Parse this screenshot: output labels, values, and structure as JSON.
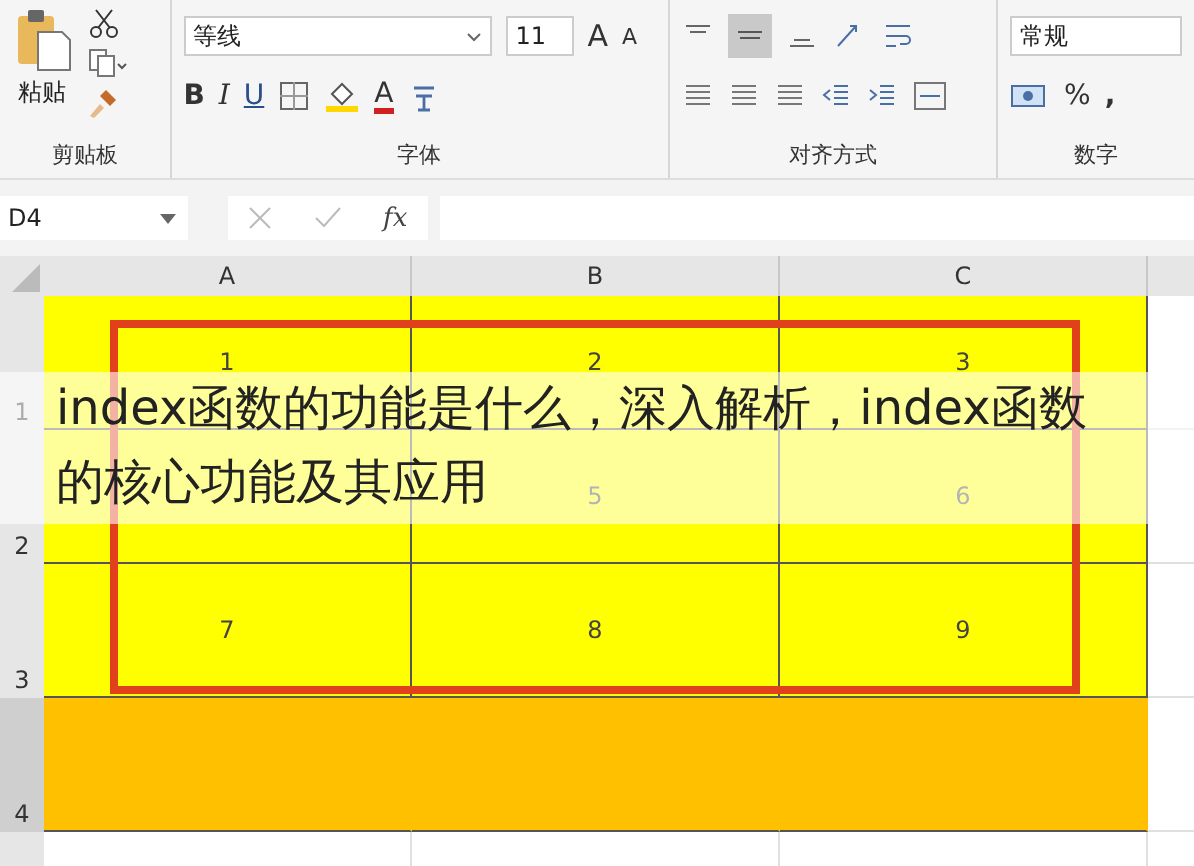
{
  "ribbon": {
    "paste_label": "粘贴",
    "font_name": "等线",
    "font_size": "11",
    "grow_font": "A",
    "shrink_font": "A",
    "bold": "B",
    "italic": "I",
    "underline": "U",
    "font_color": "A",
    "number_format": "常规",
    "percent": "%",
    "comma": ",",
    "groups": [
      {
        "label": "剪贴板"
      },
      {
        "label": "字体"
      },
      {
        "label": "对齐方式"
      },
      {
        "label": "数字"
      }
    ]
  },
  "formula_bar": {
    "name_box": "D4",
    "fx": "fx"
  },
  "columns": [
    {
      "label": "A"
    },
    {
      "label": "B"
    },
    {
      "label": "C"
    }
  ],
  "rows": [
    {
      "label": "1",
      "selected": false,
      "color": "#ffff00",
      "cells": [
        {
          "text": "1"
        },
        {
          "text": "2"
        },
        {
          "text": "3"
        }
      ]
    },
    {
      "label": "2",
      "selected": false,
      "color": "#ffff00",
      "cells": [
        {},
        {
          "text": "5"
        },
        {
          "text": "6"
        }
      ]
    },
    {
      "label": "3",
      "selected": false,
      "color": "#ffff00",
      "cells": [
        {
          "text": "7"
        },
        {
          "text": "8"
        },
        {
          "text": "9"
        }
      ]
    },
    {
      "label": "4",
      "selected": true,
      "color": "#ffc000",
      "cells": [
        {},
        {},
        {}
      ]
    }
  ],
  "caption_lines": [
    "index函数的功能是什么，深入解析，index函数",
    "的核心功能及其应用"
  ]
}
